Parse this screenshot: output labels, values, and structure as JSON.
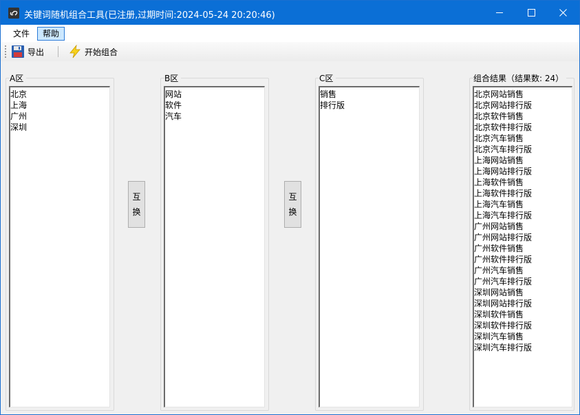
{
  "window": {
    "title": "关键词随机组合工具(已注册,过期时间:2024-05-24 20:20:46)",
    "accent_color": "#0b6fd6"
  },
  "menu": {
    "file": "文件",
    "help": "帮助"
  },
  "toolbar": {
    "export_label": "导出",
    "export_icon": "floppy-disk-icon",
    "start_label": "开始组合",
    "start_icon": "lightning-icon"
  },
  "groups": {
    "a": {
      "label": "A区",
      "items": [
        "北京",
        "上海",
        "广州",
        "深圳"
      ]
    },
    "b": {
      "label": "B区",
      "items": [
        "网站",
        "软件",
        "汽车"
      ]
    },
    "c": {
      "label": "C区",
      "items": [
        "销售",
        "排行版"
      ]
    },
    "result": {
      "label": "组合结果（结果数: 24）",
      "items": [
        "北京网站销售",
        "北京网站排行版",
        "北京软件销售",
        "北京软件排行版",
        "北京汽车销售",
        "北京汽车排行版",
        "上海网站销售",
        "上海网站排行版",
        "上海软件销售",
        "上海软件排行版",
        "上海汽车销售",
        "上海汽车排行版",
        "广州网站销售",
        "广州网站排行版",
        "广州软件销售",
        "广州软件排行版",
        "广州汽车销售",
        "广州汽车排行版",
        "深圳网站销售",
        "深圳网站排行版",
        "深圳软件销售",
        "深圳软件排行版",
        "深圳汽车销售",
        "深圳汽车排行版"
      ]
    }
  },
  "swap_buttons": {
    "first": {
      "char1": "互",
      "char2": "换"
    },
    "second": {
      "char1": "互",
      "char2": "换"
    }
  }
}
